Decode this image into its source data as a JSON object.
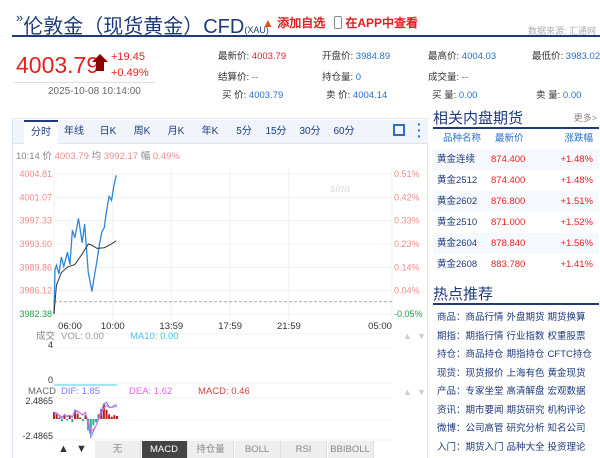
{
  "header": {
    "title": "伦敦金（现货黄金）CFD",
    "title_sub": "(XAU)",
    "add_watch": "添加自选",
    "view_app": "在APP中查看",
    "source": "数据来源: 汇通网"
  },
  "quote": {
    "price": "4003.79",
    "change": "+19.45",
    "change_pct": "+0.49%",
    "time": "2025-10-08 10:14:00",
    "fields": [
      {
        "label": "最新价:",
        "value": "4003.79",
        "color": "red"
      },
      {
        "label": "开盘价:",
        "value": "3984.89"
      },
      {
        "label": "最高价:",
        "value": "4004.03"
      },
      {
        "label": "最低价:",
        "value": "3983.02"
      },
      {
        "label": "结算价:",
        "value": "--"
      },
      {
        "label": "持仓量:",
        "value": "0"
      },
      {
        "label": "成交量:",
        "value": "--"
      },
      {
        "label": "买  价:",
        "value": "4003.79"
      },
      {
        "label": "卖  价:",
        "value": "4004.14"
      },
      {
        "label": "买  量:",
        "value": "0.00"
      },
      {
        "label": "卖  量:",
        "value": "0.00"
      }
    ]
  },
  "chart": {
    "tabs": [
      "分时",
      "年线",
      "日K",
      "周K",
      "月K",
      "年K",
      "5分",
      "15分",
      "30分",
      "60分"
    ],
    "active_tab": "分时",
    "info": {
      "time": "10:14",
      "price_label": "价",
      "price": "4003.79",
      "avg_label": "均",
      "avg": "3992.17",
      "amp_label": "幅",
      "amp": "0.49%"
    },
    "vol": {
      "label": "成交",
      "vol": "VOL: 0.00",
      "ma10": "MA10: 0.00",
      "ticks": [
        "4",
        "0"
      ]
    },
    "macd": {
      "label": "MACD",
      "dif": "DIF: 1.85",
      "dea": "DEA: 1.62",
      "macd": "MACD: 0.46",
      "ticks": [
        "2.4865",
        "-2.4865"
      ]
    },
    "indicator_buttons": [
      "无",
      "MACD",
      "持仓量",
      "BOLL",
      "RSI",
      "BBIBOLL"
    ],
    "active_indicator": "MACD",
    "watermark": "sina新浪财经"
  },
  "chart_data": {
    "type": "line",
    "x_ticks": [
      "06:00",
      "10:00",
      "13:59",
      "17:59",
      "21:59",
      "05:00"
    ],
    "y_ticks_left": [
      "4004.81",
      "4001.07",
      "3997.33",
      "3993.60",
      "3989.86",
      "3986.12",
      "3982.38"
    ],
    "y_ticks_right": [
      "0.51%",
      "0.42%",
      "0.33%",
      "0.23%",
      "0.14%",
      "0.04%",
      "-0.05%"
    ],
    "ylim": [
      3982.38,
      4004.81
    ],
    "prev_close": 3984.34,
    "series": [
      {
        "role": "price",
        "color": "#2a86d6",
        "x": [
          "06:00",
          "06:04",
          "06:10",
          "06:20",
          "06:30",
          "06:40",
          "06:55",
          "07:05",
          "07:15",
          "07:25",
          "07:40",
          "07:55",
          "08:05",
          "08:20",
          "08:35",
          "08:45",
          "08:55",
          "09:05",
          "09:15",
          "09:25",
          "09:35",
          "09:45",
          "09:55",
          "10:05",
          "10:14"
        ],
        "y": [
          3982.4,
          3989.5,
          3990.2,
          3988.8,
          3991.5,
          3990.0,
          3992.3,
          3990.3,
          3995.8,
          3994.6,
          3997.7,
          3993.8,
          3996.8,
          3989.0,
          3986.0,
          3988.5,
          3990.8,
          3993.4,
          3995.5,
          3996.2,
          3999.0,
          4001.2,
          4000.6,
          4003.0,
          4004.6
        ]
      },
      {
        "role": "average",
        "color": "#333333",
        "x": [
          "06:00",
          "06:10",
          "06:30",
          "06:55",
          "07:25",
          "07:55",
          "08:20",
          "08:35",
          "08:55",
          "09:25",
          "09:55",
          "10:14"
        ],
        "y": [
          3982.4,
          3987.0,
          3989.0,
          3989.9,
          3990.3,
          3992.0,
          3993.6,
          3993.4,
          3992.9,
          3993.0,
          3993.6,
          3994.1
        ]
      }
    ]
  },
  "macd_data": {
    "histogram": [
      0.9,
      0.6,
      0.2,
      -0.3,
      0.5,
      -0.2,
      0.4,
      -0.4,
      1.1,
      0.7,
      0.2,
      -0.3,
      0.5,
      -1.5,
      -1.9,
      -0.8,
      -0.4,
      0.6,
      1.3,
      2.0,
      1.2,
      0.6,
      0.3,
      0.5,
      0.4
    ],
    "dif": [
      0.9,
      0.8,
      0.4,
      0.1,
      0.6,
      0.3,
      0.5,
      0.2,
      1.2,
      1.0,
      0.8,
      0.5,
      0.9,
      -0.8,
      -2.4,
      -1.6,
      -0.9,
      0.3,
      1.1,
      1.9,
      2.2,
      1.6,
      1.5,
      1.8,
      1.85
    ],
    "dea": [
      0.6,
      0.7,
      0.5,
      0.3,
      0.5,
      0.4,
      0.5,
      0.3,
      0.9,
      0.9,
      0.8,
      0.6,
      0.8,
      -0.3,
      -1.6,
      -1.4,
      -0.9,
      0.0,
      0.7,
      1.4,
      1.8,
      1.5,
      1.5,
      1.6,
      1.62
    ]
  },
  "related": {
    "title": "相关内盘期货",
    "more": "更多>",
    "headers": [
      "品种名称",
      "最新价",
      "涨跌幅"
    ],
    "rows": [
      [
        "黄金连续",
        "874.400",
        "+1.48%"
      ],
      [
        "黄金2512",
        "874.400",
        "+1.48%"
      ],
      [
        "黄金2602",
        "876.800",
        "+1.51%"
      ],
      [
        "黄金2510",
        "871.000",
        "+1.52%"
      ],
      [
        "黄金2604",
        "878.840",
        "+1.56%"
      ],
      [
        "黄金2608",
        "883.780",
        "+1.41%"
      ]
    ]
  },
  "hot": {
    "title": "热点推荐",
    "rows": [
      {
        "cat": "商品：",
        "links": [
          "商品行情",
          "外盘期货",
          "期货换算"
        ]
      },
      {
        "cat": "期指：",
        "links": [
          "期指行情",
          "行业指数",
          "权重股票"
        ]
      },
      {
        "cat": "持仓：",
        "links": [
          "商品持仓",
          "期指持仓",
          "CFTC持仓"
        ]
      },
      {
        "cat": "现货：",
        "links": [
          "现货报价",
          "上海有色",
          "黄金现货"
        ]
      },
      {
        "cat": "产品：",
        "links": [
          "专家坐堂",
          "高清解盘",
          "宏观数据"
        ]
      },
      {
        "cat": "资讯：",
        "links": [
          "期市要闻",
          "期货研究",
          "机构评论"
        ]
      },
      {
        "cat": "微博：",
        "links": [
          "公司高管",
          "研究分析",
          "知名公司"
        ]
      },
      {
        "cat": "入门：",
        "links": [
          "期货入门",
          "品种大全",
          "投资理论"
        ]
      }
    ]
  },
  "colors": {
    "brand": "#1e3a7b",
    "up": "#e62020",
    "down": "#1aa34a",
    "price_line": "#2a86d6"
  }
}
